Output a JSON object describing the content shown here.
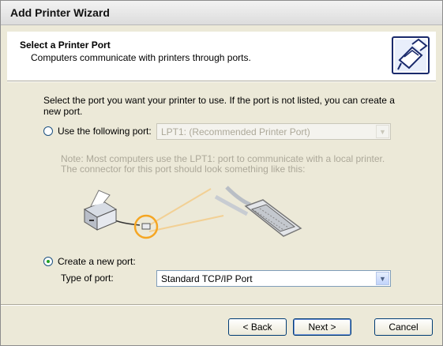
{
  "window": {
    "title": "Add Printer Wizard"
  },
  "header": {
    "title": "Select a Printer Port",
    "subtitle": "Computers communicate with printers through ports.",
    "icon": "printer-port-icon"
  },
  "instructions": "Select the port you want your printer to use.  If the port is not listed, you can create a new port.",
  "use_port": {
    "label": "Use the following port:",
    "selected": false,
    "value": "LPT1: (Recommended Printer Port)",
    "enabled": false
  },
  "note": "Note: Most computers use the LPT1: port to communicate with a local printer. The connector for this port should look something like this:",
  "create_port": {
    "label": "Create a new port:",
    "selected": true,
    "type_label": "Type of port:",
    "type_value": "Standard TCP/IP Port"
  },
  "buttons": {
    "back": "< Back",
    "next": "Next >",
    "cancel": "Cancel"
  },
  "colors": {
    "radio_dot": "#21a121",
    "disabled_text": "#aca899",
    "accent_orange": "#f5a623"
  }
}
